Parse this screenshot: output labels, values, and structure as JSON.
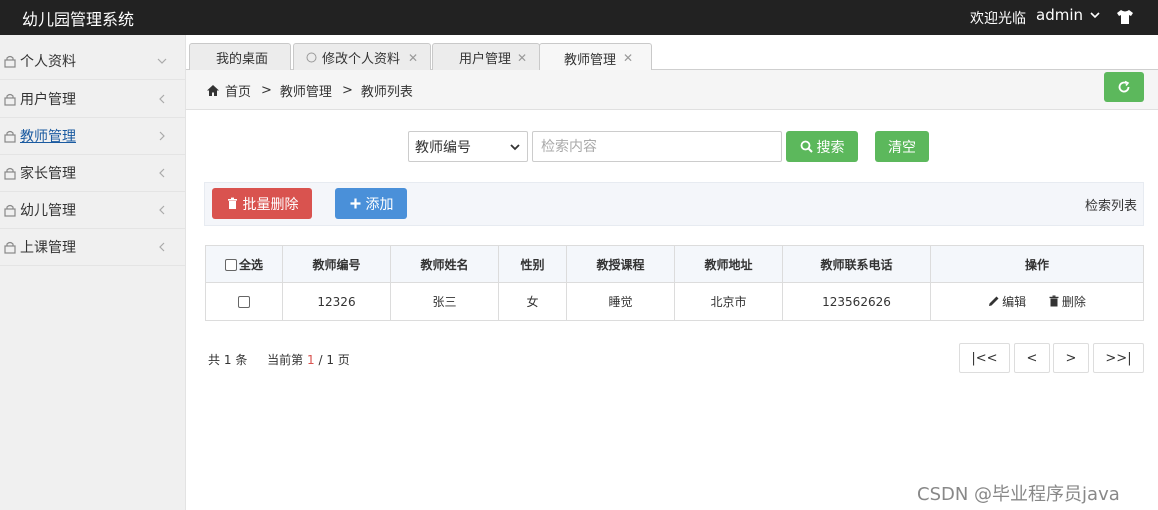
{
  "app": {
    "title": "幼儿园管理系统",
    "welcome": "欢迎光临",
    "username": "admin"
  },
  "sidebar": {
    "items": [
      {
        "label": "个人资料",
        "arrow": "chevron-down"
      },
      {
        "label": "用户管理",
        "arrow": "chevron-left"
      },
      {
        "label": "教师管理",
        "arrow": "chevron-right",
        "active": true
      },
      {
        "label": "家长管理",
        "arrow": "chevron-left"
      },
      {
        "label": "幼儿管理",
        "arrow": "chevron-left"
      },
      {
        "label": "上课管理",
        "arrow": "chevron-left"
      }
    ]
  },
  "tabs": [
    {
      "label": "我的桌面"
    },
    {
      "label": "修改个人资料"
    },
    {
      "label": "用户管理"
    },
    {
      "label": "教师管理",
      "active": true
    }
  ],
  "breadcrumb": [
    "首页",
    "教师管理",
    "教师列表"
  ],
  "search": {
    "field_selected": "教师编号",
    "placeholder": "检索内容",
    "search_label": "搜索",
    "clear_label": "清空"
  },
  "toolbar": {
    "batch_delete_label": "批量删除",
    "add_label": "添加",
    "list_title": "检索列表"
  },
  "table": {
    "select_all_label": "全选",
    "columns": [
      "教师编号",
      "教师姓名",
      "性别",
      "教授课程",
      "教师地址",
      "教师联系电话",
      "操作"
    ],
    "rows": [
      {
        "id": "12326",
        "name": "张三",
        "gender": "女",
        "course": "睡觉",
        "address": "北京市",
        "phone": "123562626"
      }
    ],
    "edit_label": "编辑",
    "delete_label": "删除"
  },
  "pagination": {
    "total_prefix": "共",
    "total": "1",
    "total_suffix": "条",
    "current_prefix": "当前第",
    "current": "1",
    "of": "/ 1 页",
    "first": "|<<",
    "prev": "<",
    "next": ">",
    "last": ">>|"
  },
  "footer_watermark": "CSDN @毕业程序员java",
  "colors": {
    "topbar": "#222222",
    "success": "#5cb85c",
    "danger": "#d9534f",
    "primary": "#4a90d9",
    "active_link": "#1a5aa0"
  }
}
